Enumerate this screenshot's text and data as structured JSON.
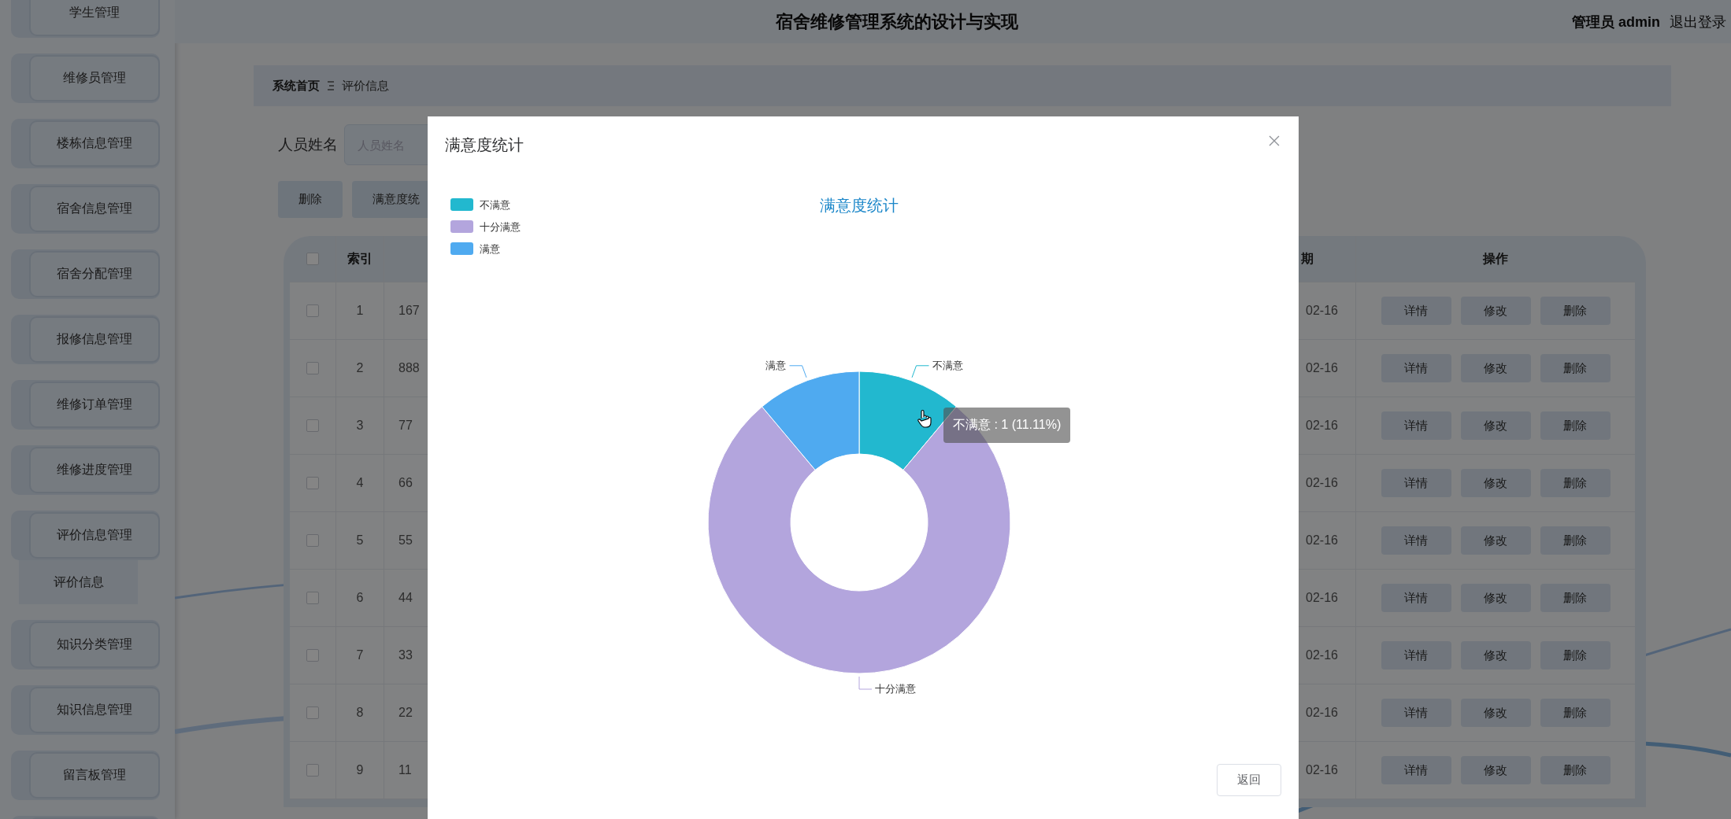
{
  "header": {
    "title": "宿舍维修管理系统的设计与实现",
    "user": "管理员 admin",
    "logout": "退出登录"
  },
  "sidebar": {
    "items": [
      {
        "label": "学生管理"
      },
      {
        "label": "维修员管理"
      },
      {
        "label": "楼栋信息管理"
      },
      {
        "label": "宿舍信息管理"
      },
      {
        "label": "宿舍分配管理"
      },
      {
        "label": "报修信息管理"
      },
      {
        "label": "维修订单管理"
      },
      {
        "label": "维修进度管理"
      },
      {
        "label": "评价信息管理",
        "children": [
          {
            "label": "评价信息"
          }
        ]
      },
      {
        "label": "知识分类管理"
      },
      {
        "label": "知识信息管理"
      },
      {
        "label": "留言板管理"
      }
    ]
  },
  "breadcrumb": {
    "home": "系统首页",
    "current": "评价信息"
  },
  "search": {
    "label": "人员姓名",
    "placeholder": "人员姓名"
  },
  "actions": [
    "删除",
    "满意度统"
  ],
  "table": {
    "header_checked": false,
    "columns": [
      "索引",
      "期",
      "操作"
    ],
    "rows": [
      {
        "checked": false,
        "index": "1",
        "column_3": "167",
        "date": "02-16",
        "buttons": [
          "详情",
          "修改",
          "删除"
        ]
      },
      {
        "checked": false,
        "index": "2",
        "column_3": "888",
        "date": "02-16",
        "buttons": [
          "详情",
          "修改",
          "删除"
        ]
      },
      {
        "checked": false,
        "index": "3",
        "column_3": "77",
        "date": "02-16",
        "buttons": [
          "详情",
          "修改",
          "删除"
        ]
      },
      {
        "checked": false,
        "index": "4",
        "column_3": "66",
        "date": "02-16",
        "buttons": [
          "详情",
          "修改",
          "删除"
        ]
      },
      {
        "checked": false,
        "index": "5",
        "column_3": "55",
        "date": "02-16",
        "buttons": [
          "详情",
          "修改",
          "删除"
        ]
      },
      {
        "checked": false,
        "index": "6",
        "column_3": "44",
        "date": "02-16",
        "buttons": [
          "详情",
          "修改",
          "删除"
        ]
      },
      {
        "checked": false,
        "index": "7",
        "column_3": "33",
        "date": "02-16",
        "buttons": [
          "详情",
          "修改",
          "删除"
        ]
      },
      {
        "checked": false,
        "index": "8",
        "column_3": "22",
        "date": "02-16",
        "buttons": [
          "详情",
          "修改",
          "删除"
        ]
      },
      {
        "checked": false,
        "index": "9",
        "column_3": "11",
        "date": "02-16",
        "buttons": [
          "详情",
          "修改",
          "删除"
        ]
      }
    ]
  },
  "dialog": {
    "title": "满意度统计",
    "legend": [
      {
        "label": "不满意",
        "color": "#22b8cf"
      },
      {
        "label": "十分满意",
        "color": "#b3a5dd"
      },
      {
        "label": "满意",
        "color": "#4faaf0"
      }
    ],
    "chart_data": {
      "type": "donut",
      "title": "满意度统计",
      "categories": [
        "不满意",
        "十分满意",
        "满意"
      ],
      "series": [
        {
          "values": [
            11.11,
            77.78,
            11.11
          ]
        }
      ]
    },
    "tooltip": "不满意 : 1 (11.11%)",
    "footer_button": "返回"
  }
}
